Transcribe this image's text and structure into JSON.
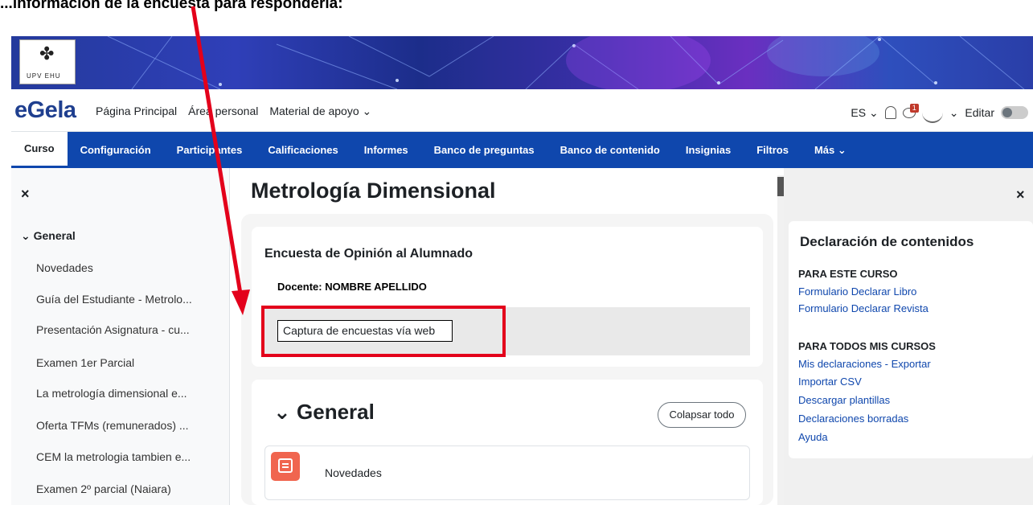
{
  "caption": "...información de la encuesta para responderla:",
  "banner": {
    "logo_text": "UPV  EHU"
  },
  "header": {
    "brand": "eGela",
    "nav": [
      "Página Principal",
      "Área personal",
      "Material de apoyo ⌄"
    ],
    "lang": "ES ⌄",
    "notif_count": "1",
    "user_caret": "⌄",
    "edit_label": "Editar"
  },
  "course_nav": {
    "items": [
      "Curso",
      "Configuración",
      "Participantes",
      "Calificaciones",
      "Informes",
      "Banco de preguntas",
      "Banco de contenido",
      "Insignias",
      "Filtros",
      "Más ⌄"
    ]
  },
  "left_drawer": {
    "close": "×",
    "section": "General",
    "items": [
      "Novedades",
      "Guía del Estudiante - Metrolo...",
      "Presentación Asignatura - cu...",
      "Examen 1er Parcial",
      "La metrología dimensional e...",
      "Oferta TFMs (remunerados) ...",
      "CEM la metrologia tambien e...",
      "Examen 2º parcial (Naiara)"
    ]
  },
  "main": {
    "course_title": "Metrología Dimensional",
    "survey_title": "Encuesta de Opinión al Alumnado",
    "teacher": "Docente: NOMBRE APELLIDO",
    "capture_button": "Captura de encuestas vía web",
    "section_title": "General",
    "collapse_all": "Colapsar todo",
    "first_activity": "Novedades"
  },
  "right_drawer": {
    "close": "×",
    "title": "Declaración de contenidos",
    "group1": {
      "heading": "PARA ESTE CURSO",
      "links": [
        "Formulario Declarar Libro",
        "Formulario Declarar Revista"
      ]
    },
    "group2": {
      "heading": "PARA TODOS MIS CURSOS",
      "links": [
        "Mis declaraciones - Exportar",
        "Importar CSV",
        "Descargar plantillas",
        "Declaraciones borradas",
        "Ayuda"
      ]
    }
  },
  "colors": {
    "primary": "#0f47ad",
    "brand": "#1f3f8f",
    "annotation": "#e3001b",
    "forum_icon": "#f0654f"
  }
}
